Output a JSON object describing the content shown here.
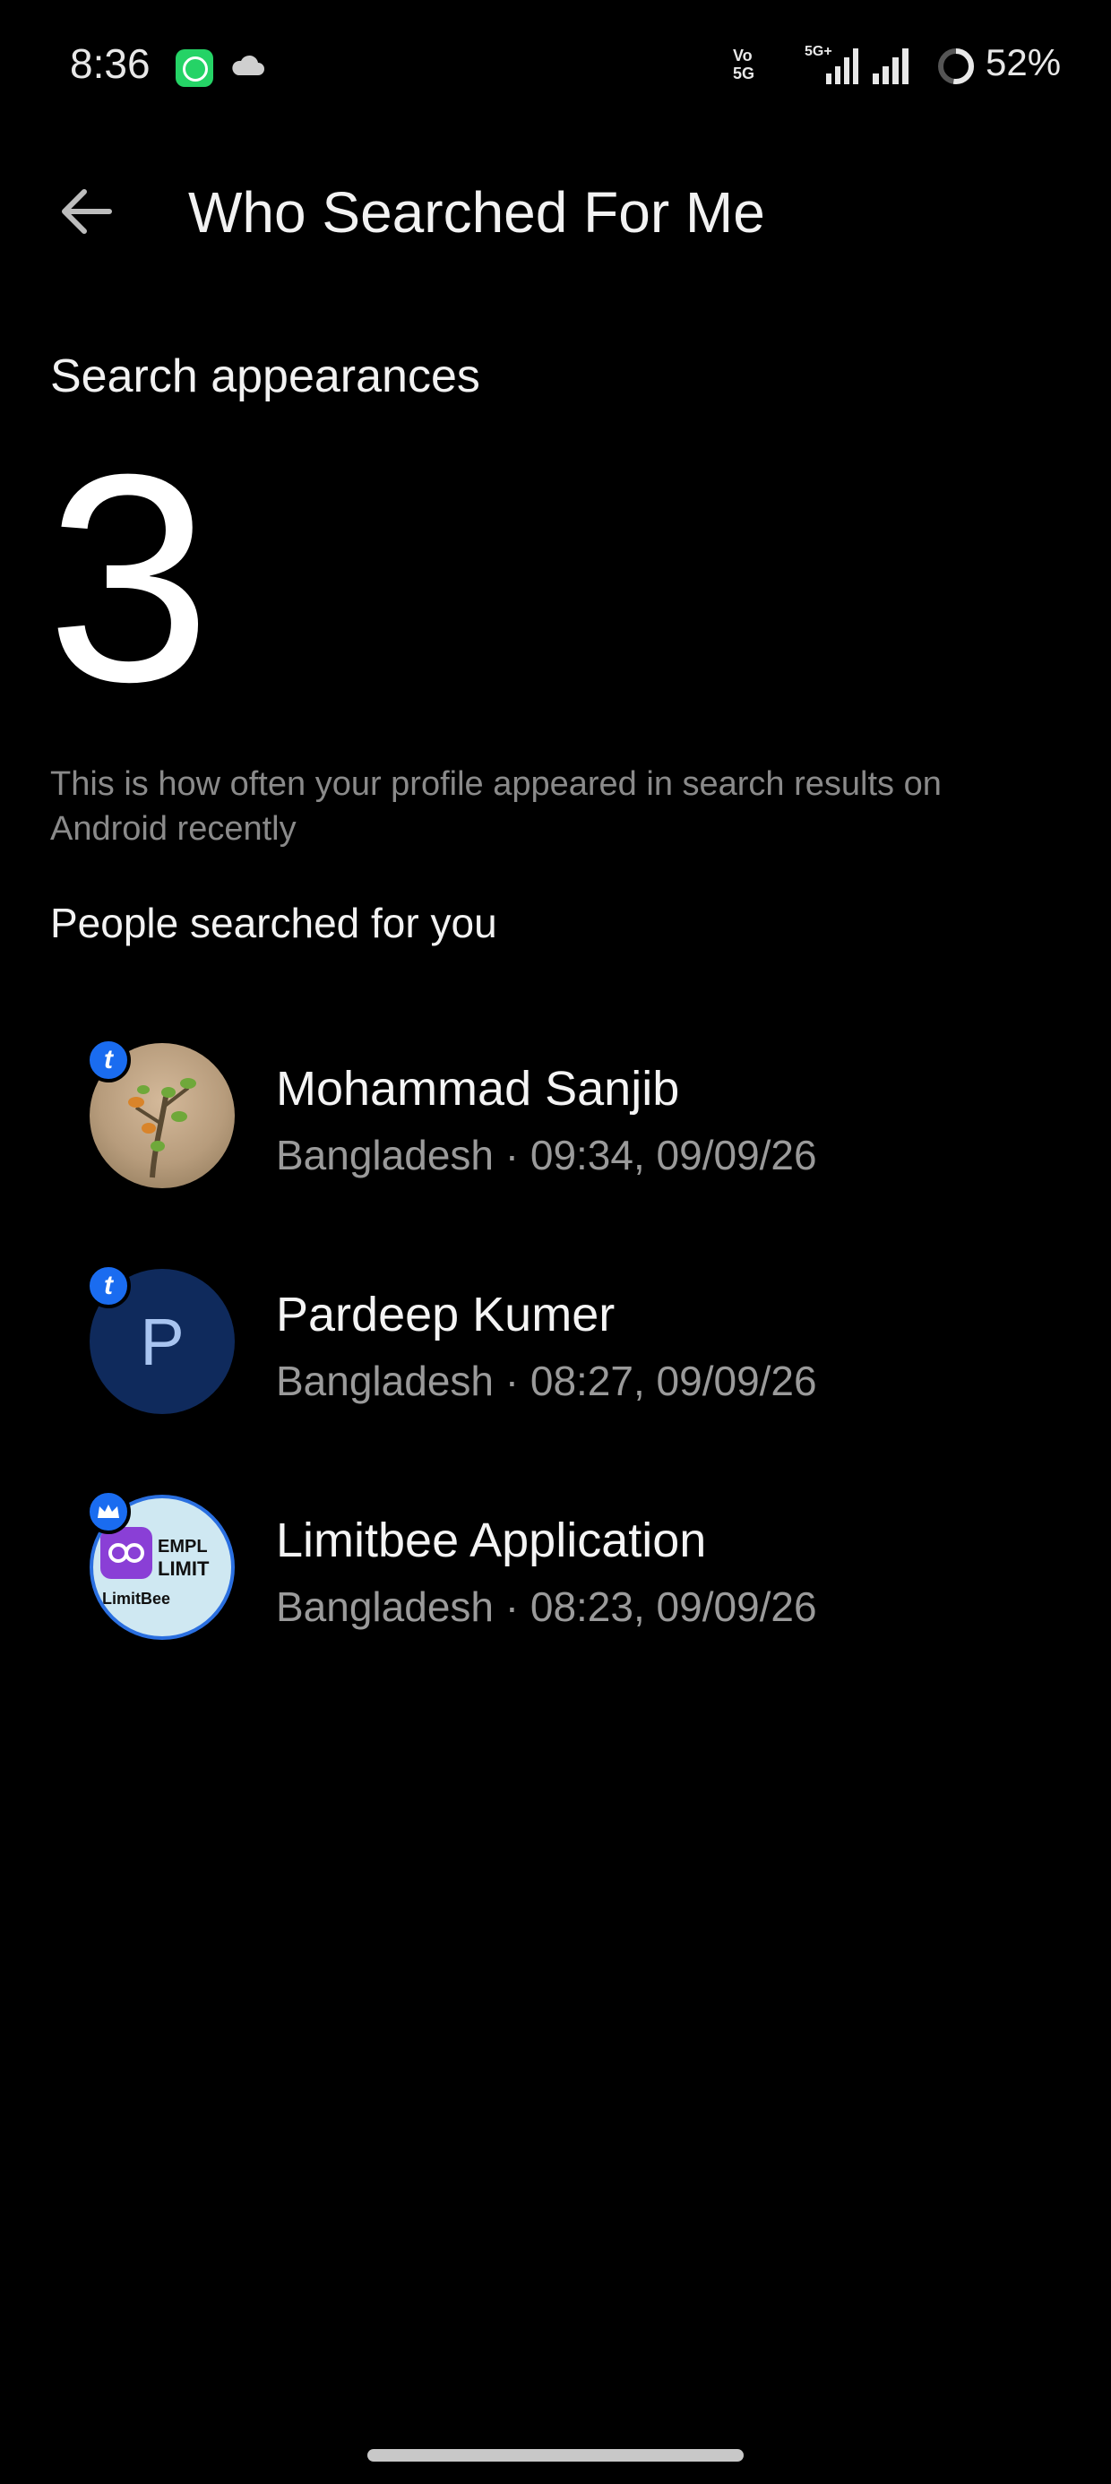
{
  "status_bar": {
    "time": "8:36",
    "network_volte": "Vo\n5G",
    "network_5g": "5G+",
    "battery": "52%",
    "icons": [
      "whatsapp-icon",
      "cloud-icon",
      "volte-icon",
      "signal-5g-icon",
      "signal-icon",
      "battery-ring-icon"
    ]
  },
  "header": {
    "back_icon": "arrow-left-icon",
    "title": "Who Searched For Me"
  },
  "summary": {
    "label": "Search appearances",
    "count": "3",
    "description": "This is how often your profile appeared in search results on Android recently"
  },
  "people": {
    "label": "People searched for you",
    "items": [
      {
        "name": "Mohammad Sanjib",
        "meta": "Bangladesh · 09:34, 09/09/26",
        "avatar": "photo-birds",
        "badge": "t"
      },
      {
        "name": "Pardeep Kumer",
        "meta": "Bangladesh · 08:27, 09/09/26",
        "avatar": "letter",
        "avatar_letter": "P",
        "badge": "t"
      },
      {
        "name": "Limitbee Application",
        "meta": "Bangladesh · 08:23, 09/09/26",
        "avatar": "app-logo",
        "avatar_text_1": "EMPL",
        "avatar_text_2": "LIMIT",
        "avatar_text_3": "LimitBee",
        "badge": "crown"
      }
    ]
  },
  "colors": {
    "background": "#000000",
    "accent_blue": "#1a6cf0",
    "muted_text": "#8a8a8a"
  }
}
